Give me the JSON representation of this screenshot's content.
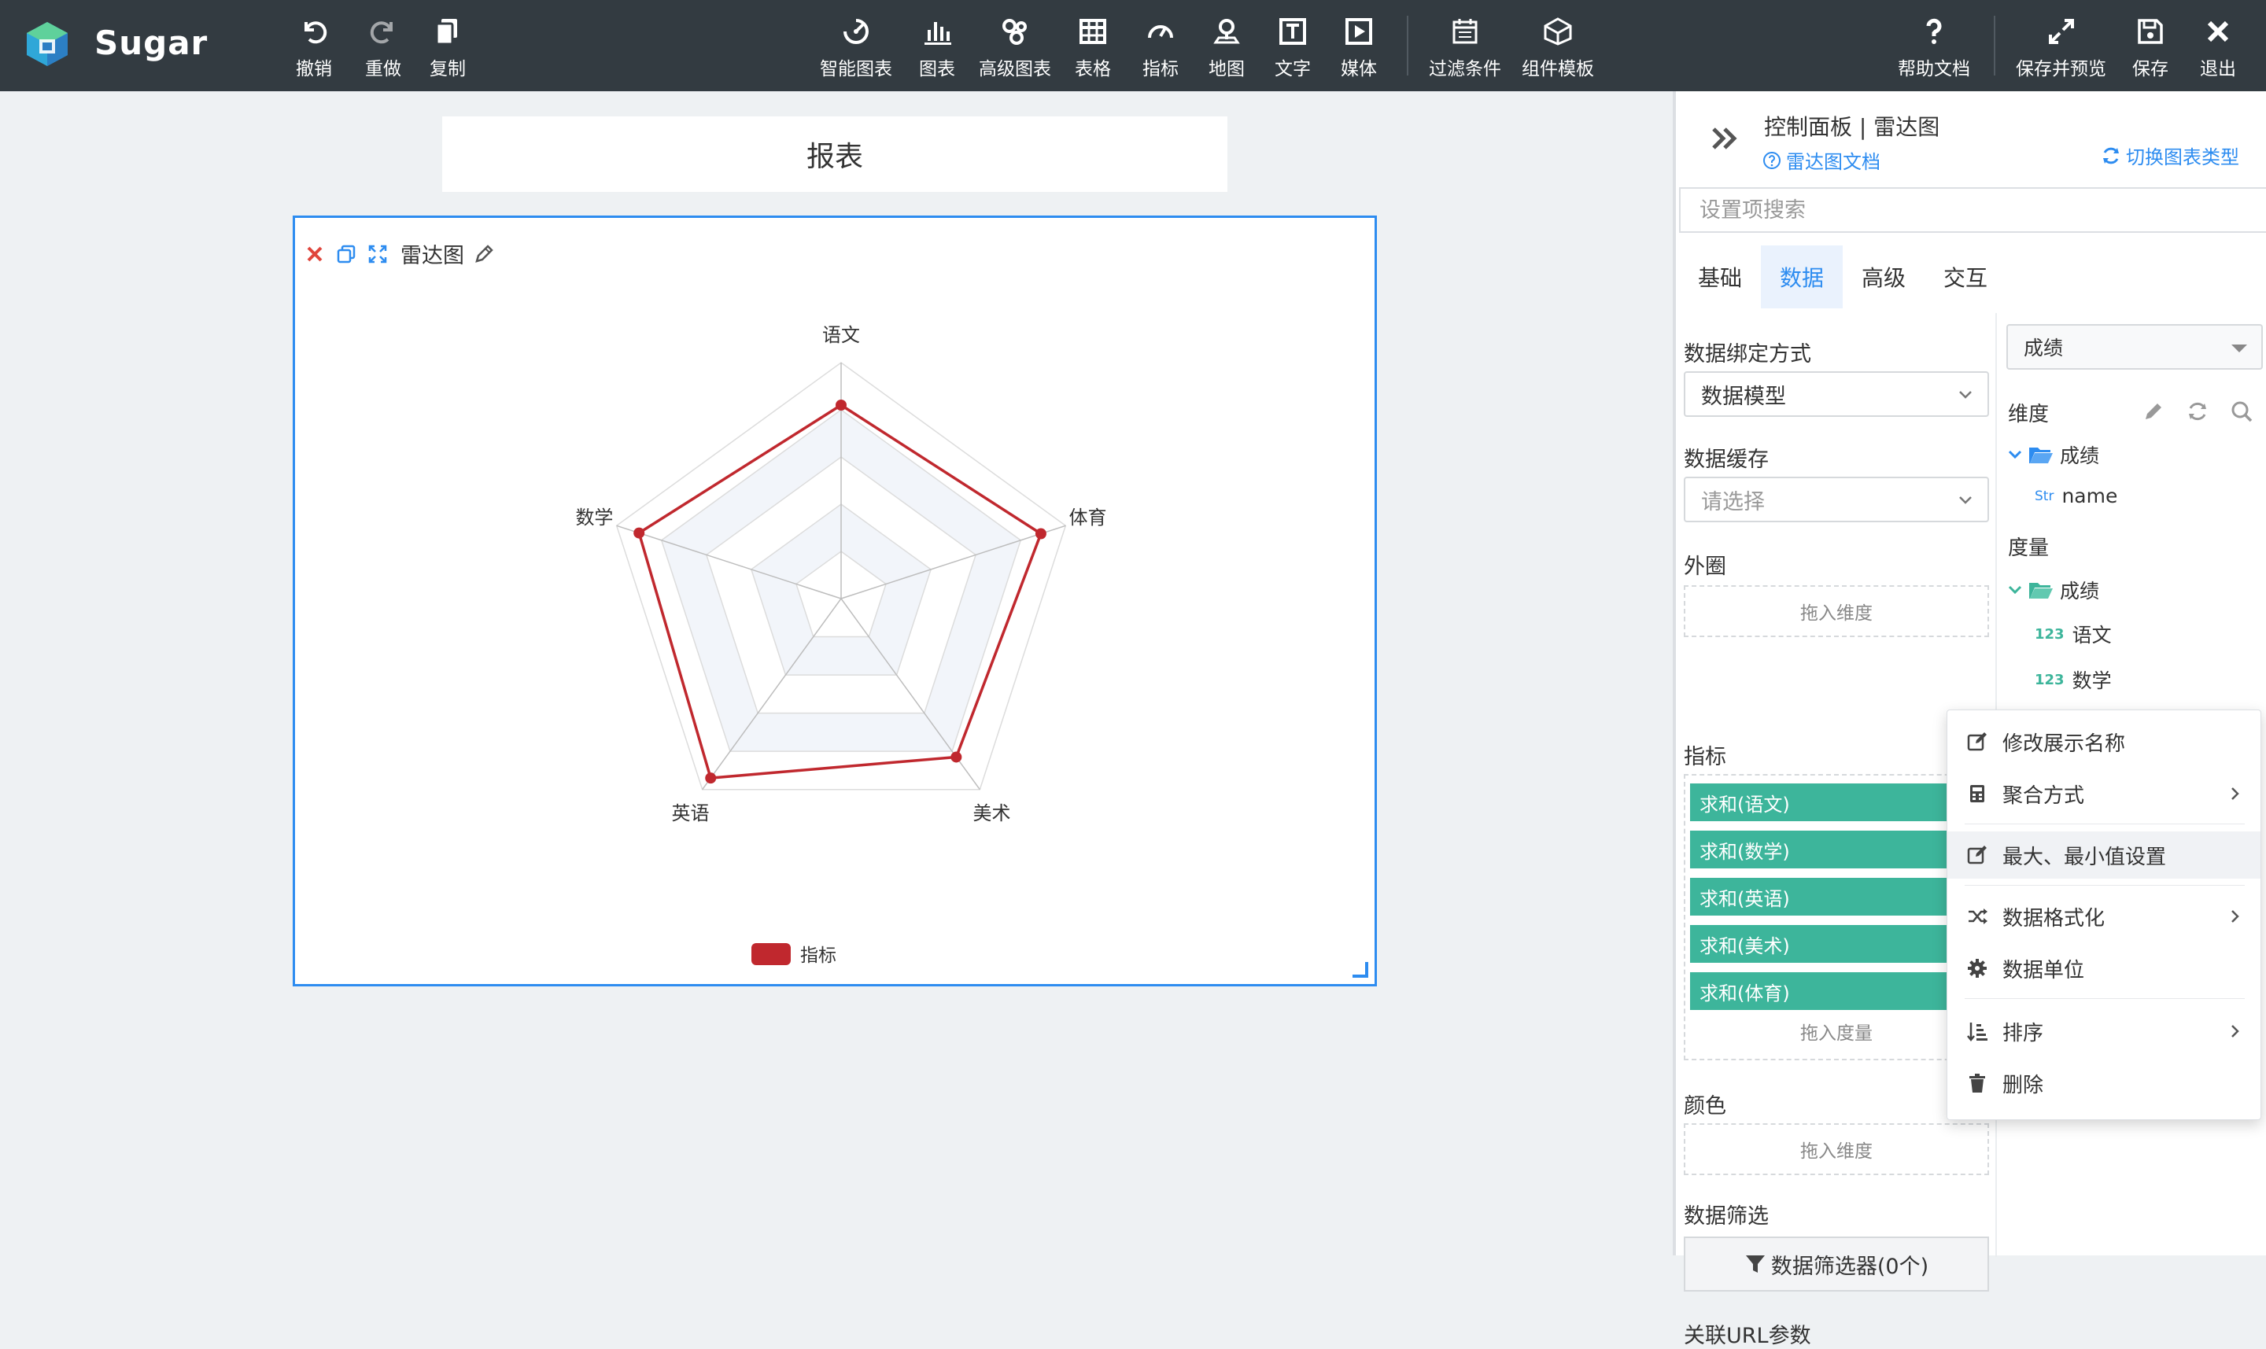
{
  "app": {
    "name": "Sugar"
  },
  "toolbar": {
    "left": [
      {
        "id": "undo",
        "label": "撤销",
        "icon": "undo-icon"
      },
      {
        "id": "redo",
        "label": "重做",
        "icon": "redo-icon",
        "disabled": true
      },
      {
        "id": "copy",
        "label": "复制",
        "icon": "copy-icon"
      }
    ],
    "center": [
      {
        "id": "smart-chart",
        "label": "智能图表",
        "icon": "smart-chart-icon"
      },
      {
        "id": "chart",
        "label": "图表",
        "icon": "bar-chart-icon"
      },
      {
        "id": "advanced-chart",
        "label": "高级图表",
        "icon": "advanced-chart-icon"
      },
      {
        "id": "table",
        "label": "表格",
        "icon": "table-icon"
      },
      {
        "id": "indicator",
        "label": "指标",
        "icon": "gauge-icon"
      },
      {
        "id": "map",
        "label": "地图",
        "icon": "map-pin-icon"
      },
      {
        "id": "text",
        "label": "文字",
        "icon": "text-icon"
      },
      {
        "id": "media",
        "label": "媒体",
        "icon": "media-play-icon"
      }
    ],
    "filters": [
      {
        "id": "filter-conditions",
        "label": "过滤条件",
        "icon": "filter-calendar-icon"
      },
      {
        "id": "component-templates",
        "label": "组件模板",
        "icon": "template-cube-icon"
      }
    ],
    "right": [
      {
        "id": "help-docs",
        "label": "帮助文档",
        "icon": "help-icon"
      },
      {
        "id": "save-preview",
        "label": "保存并预览",
        "icon": "expand-icon"
      },
      {
        "id": "save",
        "label": "保存",
        "icon": "save-icon"
      },
      {
        "id": "exit",
        "label": "退出",
        "icon": "close-icon"
      }
    ]
  },
  "canvas": {
    "report_title": "报表",
    "widget": {
      "name": "雷达图"
    }
  },
  "chart_data": {
    "type": "radar",
    "indicators": [
      "语文",
      "体育",
      "美术",
      "英语",
      "数学"
    ],
    "series": [
      {
        "name": "指标",
        "values": [
          0.82,
          0.89,
          0.83,
          0.94,
          0.9
        ]
      }
    ],
    "grid_levels": 5,
    "legend": {
      "position": "bottom",
      "entries": [
        "指标"
      ]
    },
    "colors": {
      "series": "#c0282e",
      "band": "#f2f5fa",
      "grid": "#dcdcdc"
    }
  },
  "panel": {
    "title": "控制面板 | 雷达图",
    "doc_link": "雷达图文档",
    "switch_chart_type": "切换图表类型",
    "search_placeholder": "设置项搜索",
    "tabs": [
      {
        "label": "基础",
        "active": false
      },
      {
        "label": "数据",
        "active": true
      },
      {
        "label": "高级",
        "active": false
      },
      {
        "label": "交互",
        "active": false
      }
    ],
    "binding_label": "数据绑定方式",
    "binding_value": "数据模型",
    "cache_label": "数据缓存",
    "cache_placeholder": "请选择",
    "outer_label": "外圈",
    "outer_drop": "拖入维度",
    "metrics_label": "指标",
    "metrics": [
      "求和(语文)",
      "求和(数学)",
      "求和(英语)",
      "求和(美术)",
      "求和(体育)"
    ],
    "metrics_drop": "拖入度量",
    "color_label": "颜色",
    "color_drop": "拖入维度",
    "filter_label": "数据筛选",
    "filter_button": "数据筛选器(0个)",
    "url_params_label": "关联URL参数",
    "fields": {
      "selected": "成绩",
      "dimension_label": "维度",
      "measure_label": "度量",
      "dim_folder": "成绩",
      "dim_items": [
        {
          "tag": "Str",
          "name": "name"
        }
      ],
      "measure_folder": "成绩",
      "measure_items": [
        {
          "tag": "123",
          "name": "语文"
        },
        {
          "tag": "123",
          "name": "数学"
        }
      ]
    }
  },
  "context_menu": {
    "items": [
      {
        "label": "修改展示名称",
        "icon": "edit-icon"
      },
      {
        "label": "聚合方式",
        "icon": "calculator-icon",
        "submenu": true
      },
      {
        "label": "最大、最小值设置",
        "icon": "edit-icon",
        "highlighted": true
      },
      {
        "label": "数据格式化",
        "icon": "shuffle-icon",
        "submenu": true
      },
      {
        "label": "数据单位",
        "icon": "gear-icon"
      },
      {
        "label": "排序",
        "icon": "sort-icon",
        "submenu": true
      },
      {
        "label": "删除",
        "icon": "trash-icon"
      }
    ]
  }
}
